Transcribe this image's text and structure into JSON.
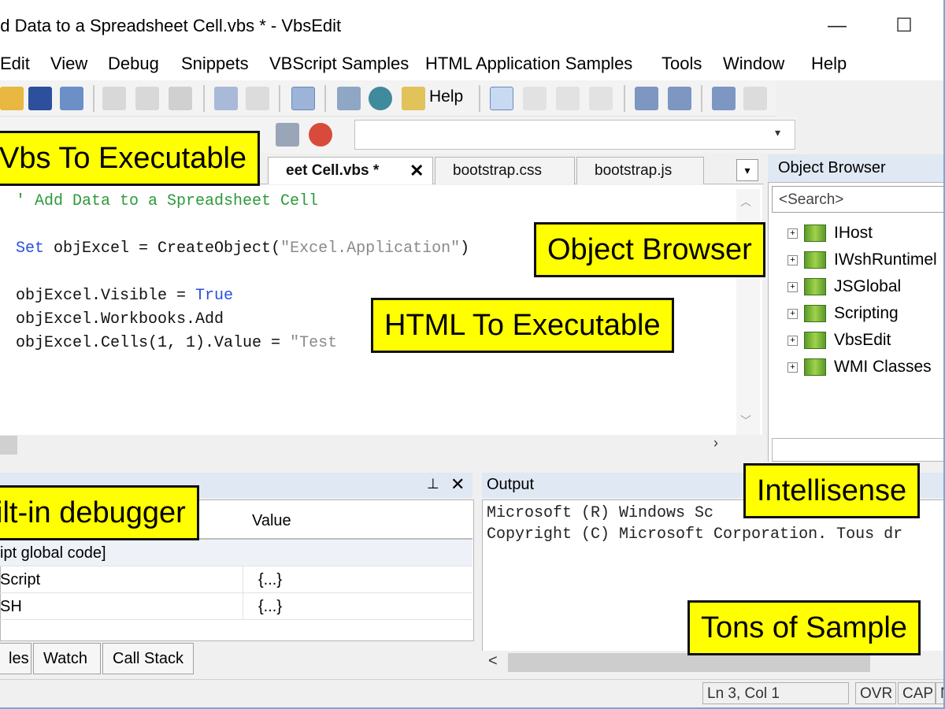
{
  "window": {
    "title": "dd Data to a Spreadsheet Cell.vbs * - VbsEdit",
    "minimize_glyph": "—",
    "maximize_glyph": "☐"
  },
  "menu": [
    "Edit",
    "View",
    "Debug",
    "Snippets",
    "VBScript Samples",
    "HTML Application Samples",
    "Tools",
    "Window",
    "Help"
  ],
  "toolbar": {
    "help_label": "Help",
    "icons": [
      "open-folder-icon",
      "save-icon",
      "save-all-icon",
      "cut-icon",
      "copy-icon",
      "paste-icon",
      "undo-icon",
      "redo-icon",
      "toggle-view-icon",
      "preview-icon",
      "run-icon",
      "help-icon",
      "comment-icon",
      "bookmark-icon",
      "bookmark-next-icon",
      "bookmark-clear-icon",
      "indent-icon",
      "outdent-icon",
      "format-icon",
      "unformat-icon",
      "breakpoint-icon"
    ],
    "combo_arrow": "▾"
  },
  "tabs": [
    {
      "label": "eet Cell.vbs *",
      "active": true
    },
    {
      "label": "bootstrap.css",
      "active": false
    },
    {
      "label": "bootstrap.js",
      "active": false
    }
  ],
  "tab_close": "✕",
  "tab_menu": "▾",
  "editor": {
    "comment": "' Add Data to a Spreadsheet Cell",
    "line_set_kw": "Set",
    "line_set_rest": " objExcel = CreateObject(",
    "line_set_str": "\"Excel.Application\"",
    "line_set_end": ")",
    "line_visible": "objExcel.Visible = ",
    "line_visible_kw": "True",
    "line_workbooks": "objExcel.Workbooks.Add",
    "line_cells": "objExcel.Cells(1, 1).Value = ",
    "line_cells_str": "\"Test"
  },
  "object_browser": {
    "title": "Object Browser",
    "search_placeholder": "<Search>",
    "items": [
      "IHost",
      "IWshRuntimel",
      "JSGlobal",
      "Scripting",
      "VbsEdit",
      "WMI Classes"
    ]
  },
  "locals": {
    "column_value": "Value",
    "group_row": "ipt global code]",
    "rows": [
      {
        "name": "Script",
        "value": "{...}"
      },
      {
        "name": "SH",
        "value": "{...}"
      }
    ],
    "pin_glyph": "⊥",
    "close_glyph": "✕"
  },
  "bottom_tabs": [
    "les",
    "Watch",
    "Call Stack"
  ],
  "output": {
    "title": "Output",
    "lines": [
      "Microsoft (R) Windows Sc",
      "Copyright (C) Microsoft Corporation. Tous dr"
    ],
    "scroll_left": "<"
  },
  "status": {
    "position": "Ln 3, Col 1",
    "ovr": "OVR",
    "cap": "CAP",
    "num": "N"
  },
  "callouts": {
    "vbs_to_exe": "Vbs To Executable",
    "object_browser": "Object Browser",
    "html_to_exe": "HTML To Executable",
    "debugger": "ilt-in debugger",
    "intellisense": "Intellisense",
    "samples": "Tons of Sample"
  },
  "colors": {
    "callout_bg": "#ffff00",
    "comment": "#2c9a3a",
    "keyword": "#2a4fe0",
    "string": "#8a8a8a",
    "panel_header": "#dfe8f3"
  }
}
